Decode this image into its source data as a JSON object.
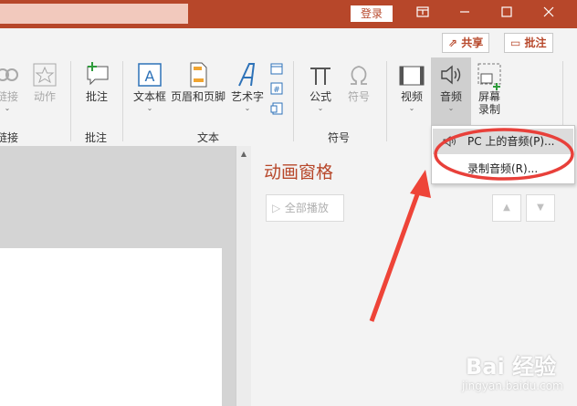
{
  "titlebar": {
    "login_label": "登录",
    "colors": {
      "bar": "#b7472a",
      "accent": "#b7472a"
    },
    "buttons": [
      "restore-icon",
      "minimize-icon",
      "maximize-icon",
      "close-icon"
    ]
  },
  "ribbon_top": {
    "share_label": "共享",
    "comment_label": "批注"
  },
  "ribbon": {
    "link_label": "链接",
    "action_label": "动作",
    "link_group_label": "链接",
    "comment_btn_label": "批注",
    "comment_group_label": "批注",
    "textbox_label": "文本框",
    "header_footer_label": "页眉和页脚",
    "wordart_label": "艺术字",
    "text_group_label": "文本",
    "equation_label": "公式",
    "symbol_label": "符号",
    "symbols_group_label": "符号",
    "video_label": "视频",
    "audio_label": "音频",
    "screen_record_label1": "屏幕",
    "screen_record_label2": "录制"
  },
  "audio_menu": {
    "item1": "PC 上的音频(P)...",
    "item2": "录制音频(R)..."
  },
  "animation_pane": {
    "title": "动画窗格",
    "play_all_label": "全部播放"
  },
  "watermark": {
    "main": "Bai 经验",
    "sub": "jingyan.baidu.com"
  }
}
